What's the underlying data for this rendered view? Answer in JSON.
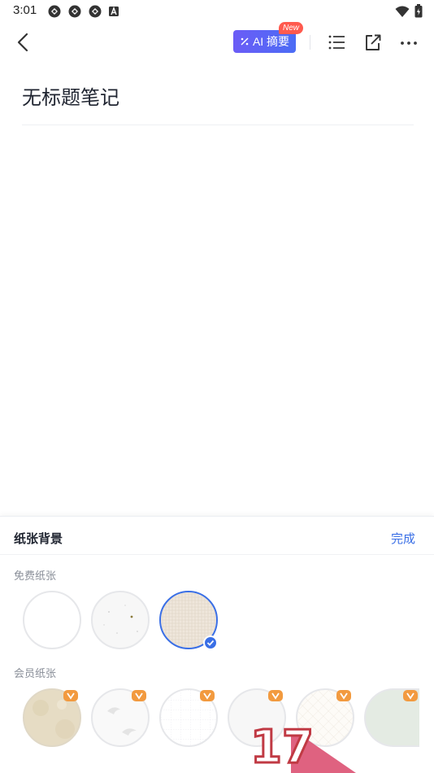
{
  "status_bar": {
    "time": "3:01",
    "left_icons": [
      "sync-icon",
      "sync-icon",
      "sync-icon",
      "text-a-icon"
    ],
    "right_icons": [
      "wifi-icon",
      "battery-icon"
    ]
  },
  "toolbar": {
    "back_icon": "chevron-left-icon",
    "ai_button_label": "AI 摘要",
    "ai_badge": "New",
    "icons": [
      "outline-list-icon",
      "share-icon",
      "more-icon"
    ]
  },
  "note": {
    "title": "无标题笔记"
  },
  "paper_sheet": {
    "title": "纸张背景",
    "done_label": "完成",
    "free_section": {
      "label": "免费纸张",
      "papers": [
        {
          "name": "plain-white",
          "selected": false,
          "color": "#ffffff"
        },
        {
          "name": "speckled-white",
          "selected": false,
          "color": "#f7f7f7"
        },
        {
          "name": "linen-beige",
          "selected": true,
          "color": "#efe7dc"
        }
      ]
    },
    "member_section": {
      "label": "会员纸张",
      "papers": [
        {
          "name": "parchment",
          "color": "#e6dcc4"
        },
        {
          "name": "crane-print",
          "color": "#f9f9f9"
        },
        {
          "name": "dot-grid",
          "color": "#ffffff"
        },
        {
          "name": "soft-texture",
          "color": "#f7f7f7"
        },
        {
          "name": "diagonal-grid",
          "color": "#fdfbf7"
        },
        {
          "name": "mint-paper",
          "color": "#e4ebe3"
        }
      ]
    }
  },
  "watermark_text": "17",
  "colors": {
    "accent": "#3a6fe6",
    "ai_gradient_start": "#6b5cf6",
    "ai_gradient_end": "#4b6cf5",
    "badge": "#ff5a4e",
    "vip_badge": "#f29a3f"
  }
}
